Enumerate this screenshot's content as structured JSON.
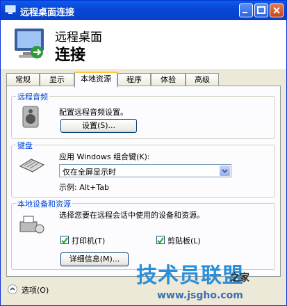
{
  "window": {
    "title": "远程桌面连接"
  },
  "banner": {
    "line1": "远程桌面",
    "line2": "连接"
  },
  "tabs": [
    {
      "label": "常规"
    },
    {
      "label": "显示"
    },
    {
      "label": "本地资源"
    },
    {
      "label": "程序"
    },
    {
      "label": "体验"
    },
    {
      "label": "高级"
    }
  ],
  "audio": {
    "legend": "远程音频",
    "desc": "配置远程音频设置。",
    "button": "设置(S)..."
  },
  "keyboard": {
    "legend": "键盘",
    "desc": "应用 Windows 组合键(K):",
    "selected": "仅在全屏显示时",
    "example": "示例: Alt+Tab"
  },
  "devices": {
    "legend": "本地设备和资源",
    "desc": "选择您要在远程会话中使用的设备和资源。",
    "printer": "打印机(T)",
    "clipboard": "剪贴板(L)",
    "details": "详细信息(M)..."
  },
  "footer": {
    "options": "选项(O)"
  },
  "watermark": {
    "text": "技术员联盟",
    "url": "www.jsgho.com",
    "extra": "之家"
  },
  "colors": {
    "titlebar": "#0a50dc",
    "group_label": "#0046d5",
    "checkbox_mark": "#21a121"
  }
}
